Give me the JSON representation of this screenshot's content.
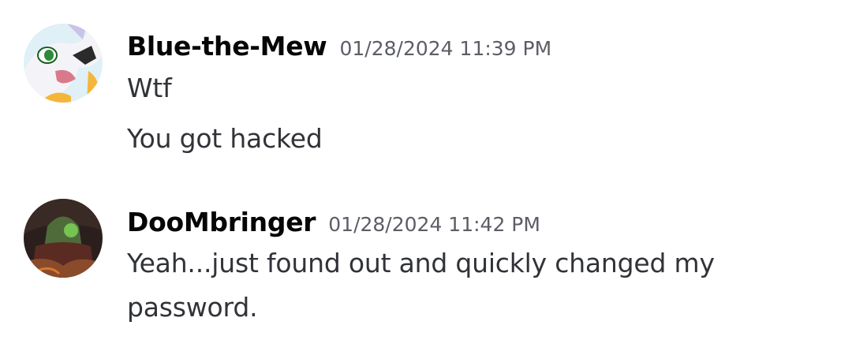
{
  "messages": [
    {
      "username": "Blue-the-Mew",
      "timestamp": "01/28/2024 11:39 PM",
      "avatar_icon": "white-cat-avatar-icon",
      "lines": [
        "Wtf",
        "You got hacked"
      ]
    },
    {
      "username": "DooMbringer",
      "timestamp": "01/28/2024 11:42 PM",
      "avatar_icon": "dark-warrior-avatar-icon",
      "lines": [
        "Yeah...just found out and quickly changed my",
        "password."
      ]
    }
  ],
  "colors": {
    "username": "#060607",
    "text": "#313338",
    "timestamp": "#5c5e66",
    "background": "#ffffff"
  }
}
